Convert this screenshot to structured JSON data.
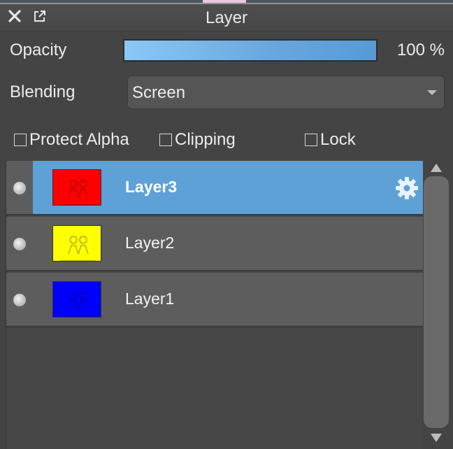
{
  "panel": {
    "title": "Layer"
  },
  "opacity": {
    "label": "Opacity",
    "value_text": "100 %",
    "value_fraction": 1.0
  },
  "blending": {
    "label": "Blending",
    "selected": "Screen"
  },
  "options": {
    "protect_alpha": {
      "label": "Protect Alpha",
      "checked": false
    },
    "clipping": {
      "label": "Clipping",
      "checked": false
    },
    "lock": {
      "label": "Lock",
      "checked": false
    }
  },
  "layers": [
    {
      "name": "Layer3",
      "thumb_color": "#ff0000",
      "selected": true
    },
    {
      "name": "Layer2",
      "thumb_color": "#ffff00",
      "selected": false
    },
    {
      "name": "Layer1",
      "thumb_color": "#0000ff",
      "selected": false
    }
  ],
  "colors": {
    "selection": "#5ea1d6",
    "opacity_fill": "#6aa9df"
  },
  "icons": {
    "close": "close-icon",
    "popout": "popout-icon",
    "settings": "gear-icon"
  }
}
